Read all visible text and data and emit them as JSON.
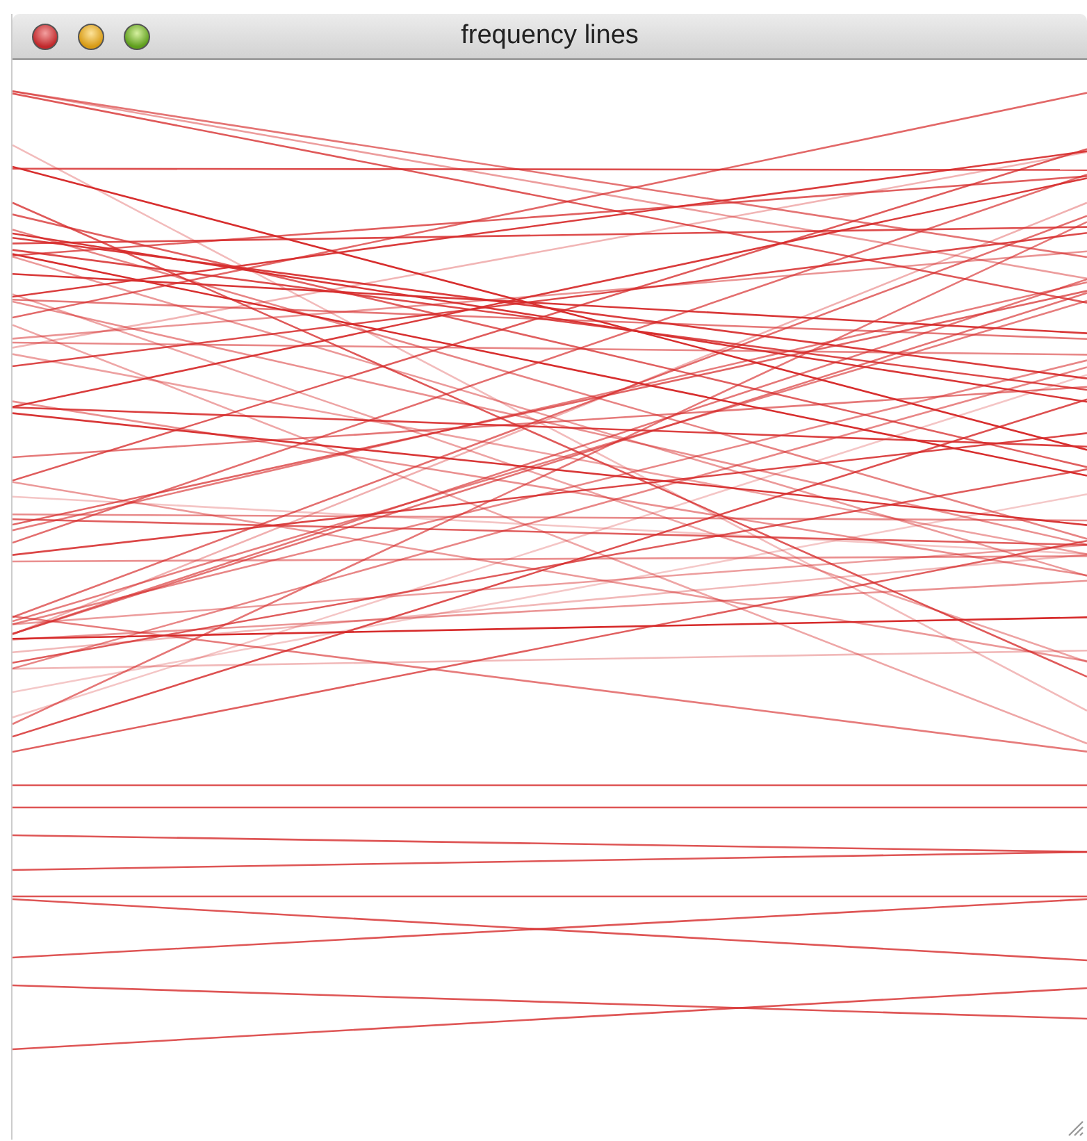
{
  "window": {
    "title": "frequency lines"
  }
}
